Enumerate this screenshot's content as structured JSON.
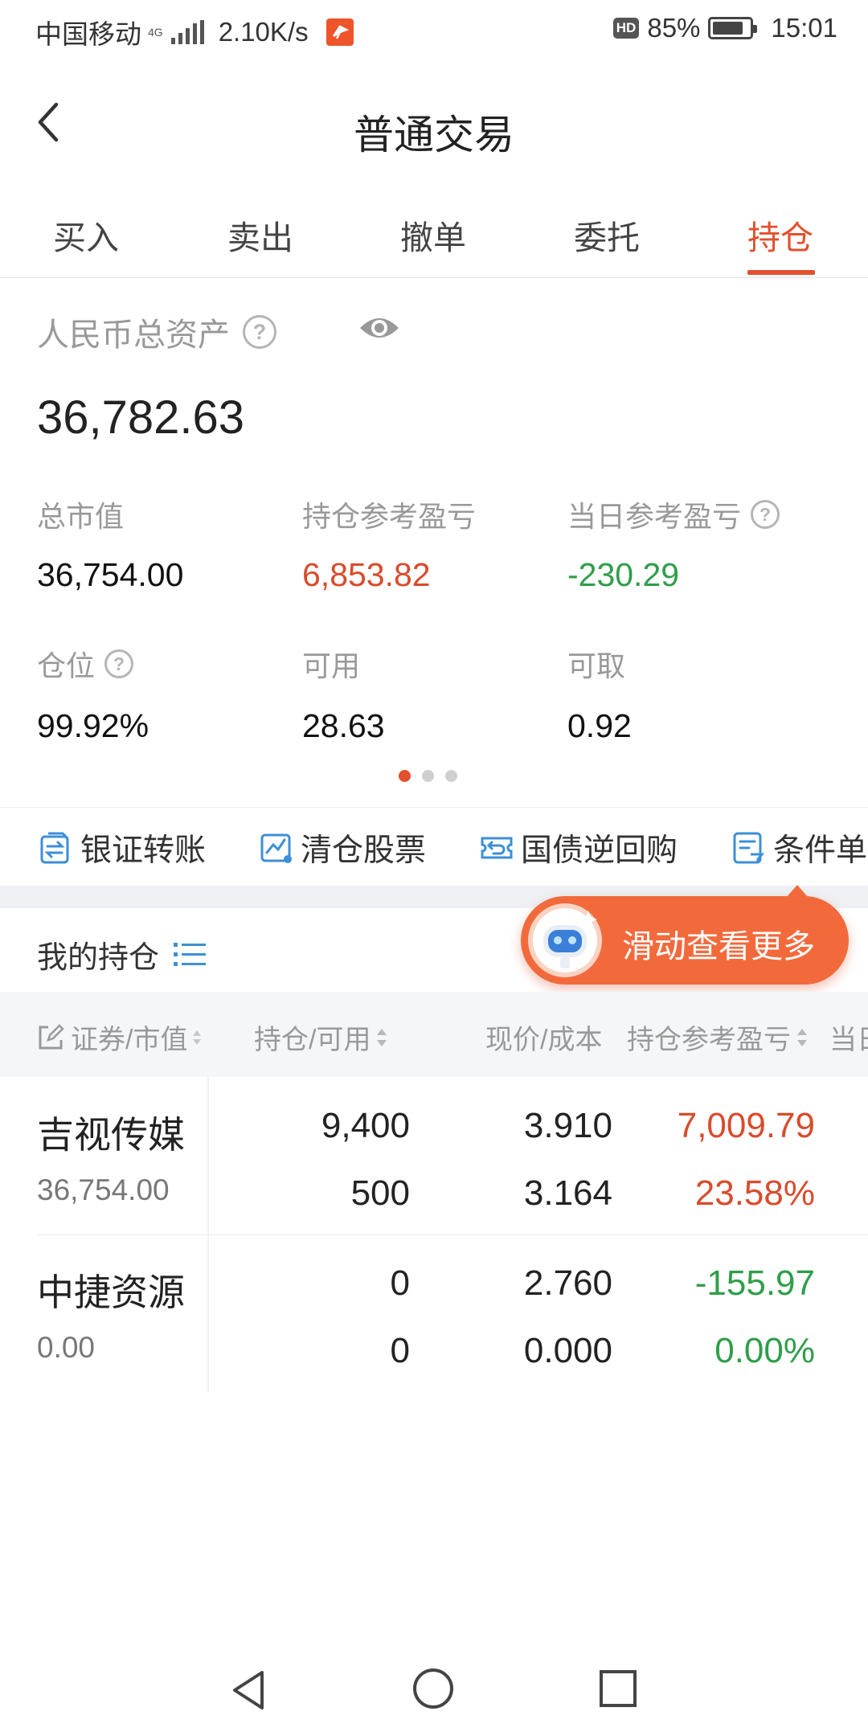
{
  "status_bar": {
    "carrier": "中国移动",
    "network": "4G",
    "speed": "2.10K/s",
    "battery": "85%",
    "battery_level": 0.85,
    "time": "15:01",
    "hd_label": "HD"
  },
  "header": {
    "title": "普通交易",
    "back_icon": "chevron-left-icon"
  },
  "tabs": [
    {
      "label": "买入",
      "active": false
    },
    {
      "label": "卖出",
      "active": false
    },
    {
      "label": "撤单",
      "active": false
    },
    {
      "label": "委托",
      "active": false
    },
    {
      "label": "持仓",
      "active": true
    }
  ],
  "summary": {
    "total_label": "人民币总资产",
    "total_value": "36,782.63",
    "carousel_index": 0,
    "carousel_pages": 3,
    "stats": [
      {
        "label": "总市值",
        "value": "36,754.00",
        "tone": "neutral",
        "help": false
      },
      {
        "label": "持仓参考盈亏",
        "value": "6,853.82",
        "tone": "up",
        "help": false
      },
      {
        "label": "当日参考盈亏",
        "value": "-230.29",
        "tone": "down",
        "help": true
      },
      {
        "label": "仓位",
        "value": "99.92%",
        "tone": "neutral",
        "help": true
      },
      {
        "label": "可用",
        "value": "28.63",
        "tone": "neutral",
        "help": false
      },
      {
        "label": "可取",
        "value": "0.92",
        "tone": "neutral",
        "help": false
      }
    ]
  },
  "actions": [
    {
      "label": "银证转账",
      "icon": "transfer-icon"
    },
    {
      "label": "清仓股票",
      "icon": "chart-icon"
    },
    {
      "label": "国债逆回购",
      "icon": "repo-icon"
    },
    {
      "label": "条件单",
      "icon": "condition-icon"
    }
  ],
  "holdings": {
    "title": "我的持仓",
    "tooltip": "滑动查看更多",
    "columns": [
      "证券/市值",
      "持仓/可用",
      "现价/成本",
      "持仓参考盈亏",
      "当日"
    ],
    "rows": [
      {
        "name": "吉视传媒",
        "market_value": "36,754.00",
        "position": "9,400",
        "available": "500",
        "price": "3.910",
        "cost": "3.164",
        "pl": "7,009.79",
        "pl_pct": "23.58%",
        "tone": "up"
      },
      {
        "name": "中捷资源",
        "market_value": "0.00",
        "position": "0",
        "available": "0",
        "price": "2.760",
        "cost": "0.000",
        "pl": "-155.97",
        "pl_pct": "0.00%",
        "tone": "down"
      }
    ]
  },
  "colors": {
    "accent": "#e2502d",
    "up": "#d94b2c",
    "down": "#2f9e4a",
    "action_icon": "#3d8fd6"
  }
}
